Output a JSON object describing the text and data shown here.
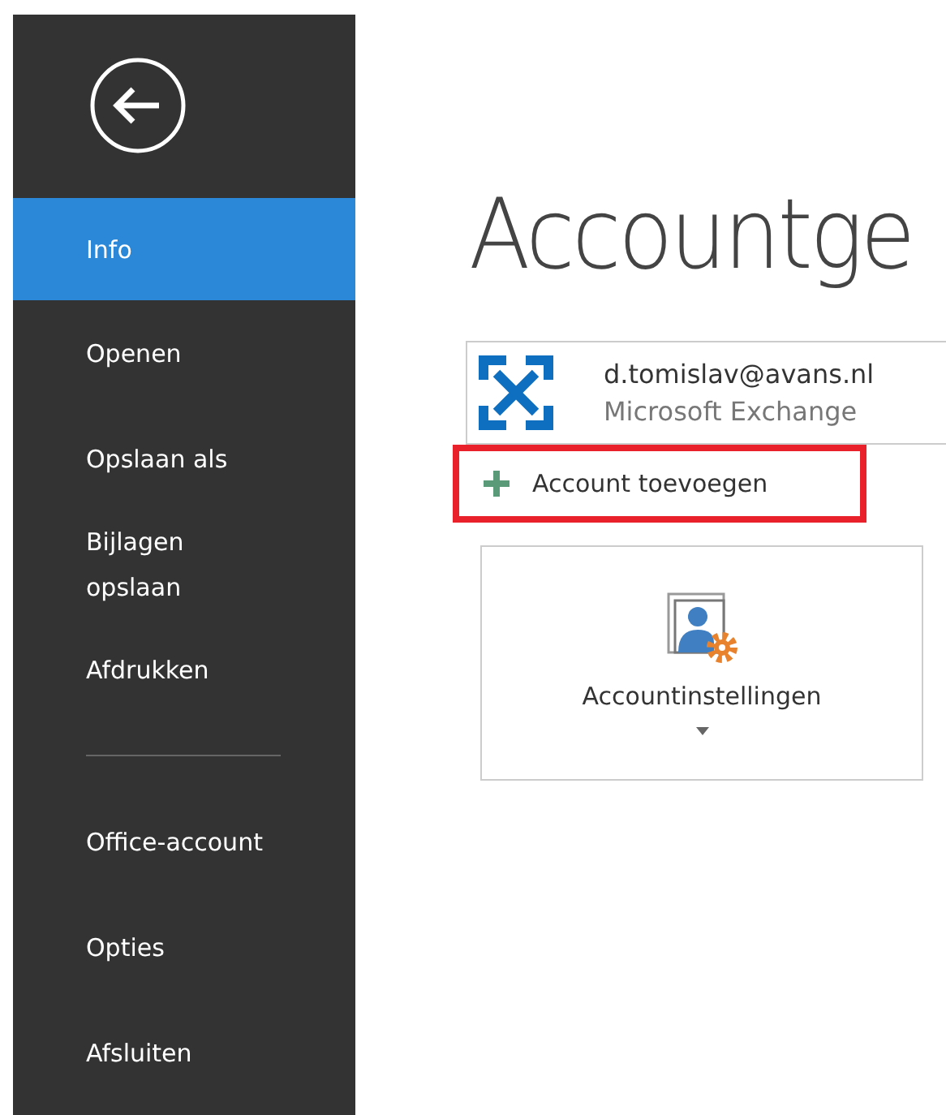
{
  "sidebar": {
    "items": [
      {
        "label": "Info",
        "selected": true
      },
      {
        "label": "Openen",
        "selected": false
      },
      {
        "label": "Opslaan als",
        "selected": false
      },
      {
        "label": "Bijlagen\nopslaan",
        "selected": false
      },
      {
        "label": "Afdrukken",
        "selected": false
      },
      {
        "kind": "divider"
      },
      {
        "label": "Office-account",
        "selected": false
      },
      {
        "label": "Opties",
        "selected": false
      },
      {
        "label": "Afsluiten",
        "selected": false
      }
    ]
  },
  "title": "Accountge",
  "account": {
    "email": "d.tomislav@avans.nl",
    "type": "Microsoft Exchange"
  },
  "add_account": {
    "label": "Account toevoegen",
    "highlighted": true
  },
  "settings_tile": {
    "label": "Accountinstellingen"
  }
}
